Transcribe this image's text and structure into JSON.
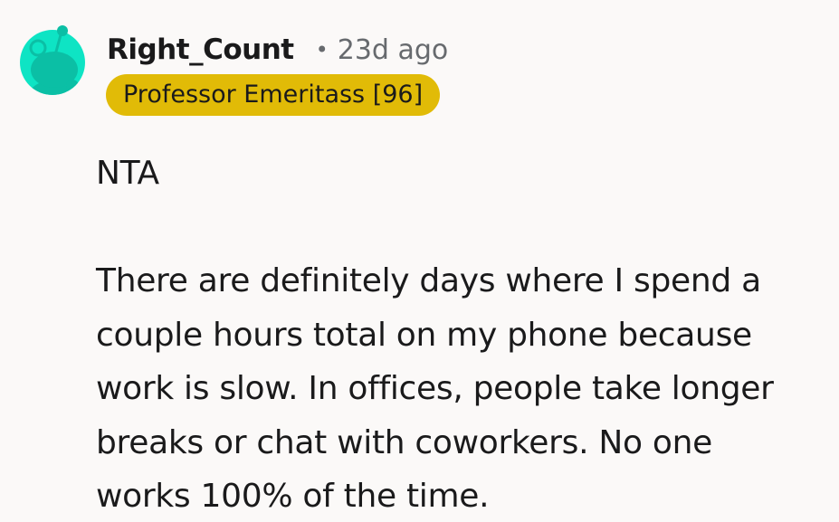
{
  "comment": {
    "author": "Right_Count",
    "separator": "•",
    "timestamp": "23d ago",
    "flair": "Professor Emeritass [96]",
    "body": {
      "verdict": "NTA",
      "lines": [
        "There are definitely days where I spend a",
        "couple hours total on my phone because",
        "work is slow. In offices, people take longer",
        "breaks or chat with coworkers. No one",
        "works 100% of the time."
      ]
    }
  },
  "colors": {
    "background": "#fbf9f8",
    "avatar_bg": "#0ee4c4",
    "flair_bg": "#e1bb07",
    "meta_text": "#676a6e"
  },
  "icons": {
    "avatar": "snoo-avatar-icon"
  }
}
